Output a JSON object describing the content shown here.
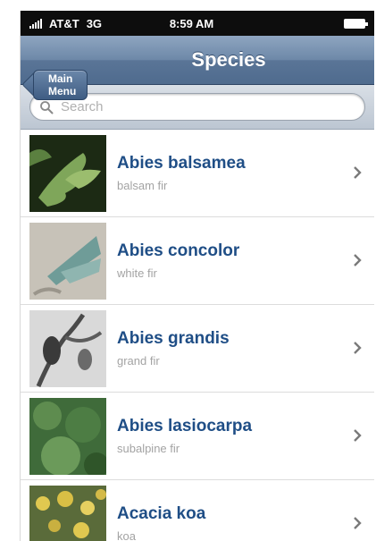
{
  "status_bar": {
    "carrier": "AT&T",
    "network": "3G",
    "time": "8:59 AM"
  },
  "nav": {
    "back_label": "Main Menu",
    "title": "Species"
  },
  "search": {
    "placeholder": "Search"
  },
  "species": [
    {
      "scientific": "Abies balsamea",
      "common": "balsam fir",
      "thumb": "green-needles"
    },
    {
      "scientific": "Abies concolor",
      "common": "white fir",
      "thumb": "blue-needles"
    },
    {
      "scientific": "Abies grandis",
      "common": "grand fir",
      "thumb": "grayscale-branch"
    },
    {
      "scientific": "Abies lasiocarpa",
      "common": "subalpine fir",
      "thumb": "green-conifer"
    },
    {
      "scientific": "Acacia koa",
      "common": "koa",
      "thumb": "yellow-flowers"
    }
  ],
  "colors": {
    "nav_bar": "#5a7597",
    "title_text": "#1f4e86",
    "subtitle_text": "#a3a3a3"
  }
}
